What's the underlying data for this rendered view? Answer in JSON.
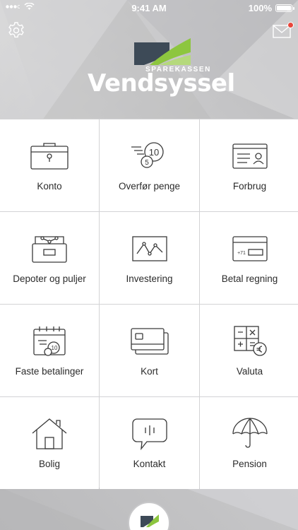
{
  "status_bar": {
    "time": "9:41 AM",
    "battery": "100%"
  },
  "brand": {
    "line1": "SPAREKASSEN",
    "name": "Vendsyssel"
  },
  "tiles": [
    {
      "label": "Konto",
      "icon": "briefcase-icon"
    },
    {
      "label": "Overfør penge",
      "icon": "coins-transfer-icon"
    },
    {
      "label": "Forbrug",
      "icon": "id-card-icon"
    },
    {
      "label": "Depoter og puljer",
      "icon": "drawer-box-icon"
    },
    {
      "label": "Investering",
      "icon": "line-chart-icon"
    },
    {
      "label": "Betal regning",
      "icon": "bill-icon",
      "bill_code": "+71"
    },
    {
      "label": "Faste betalinger",
      "icon": "calendar-coin-icon",
      "coin": "10"
    },
    {
      "label": "Kort",
      "icon": "cards-icon"
    },
    {
      "label": "Valuta",
      "icon": "calculator-euro-icon"
    },
    {
      "label": "Bolig",
      "icon": "house-icon"
    },
    {
      "label": "Kontakt",
      "icon": "chat-bubble-icon"
    },
    {
      "label": "Pension",
      "icon": "umbrella-icon"
    }
  ],
  "coin_labels": {
    "big": "10",
    "small": "5"
  },
  "colors": {
    "brand_green": "#8dc63f",
    "brand_dark": "#3d4a57"
  }
}
